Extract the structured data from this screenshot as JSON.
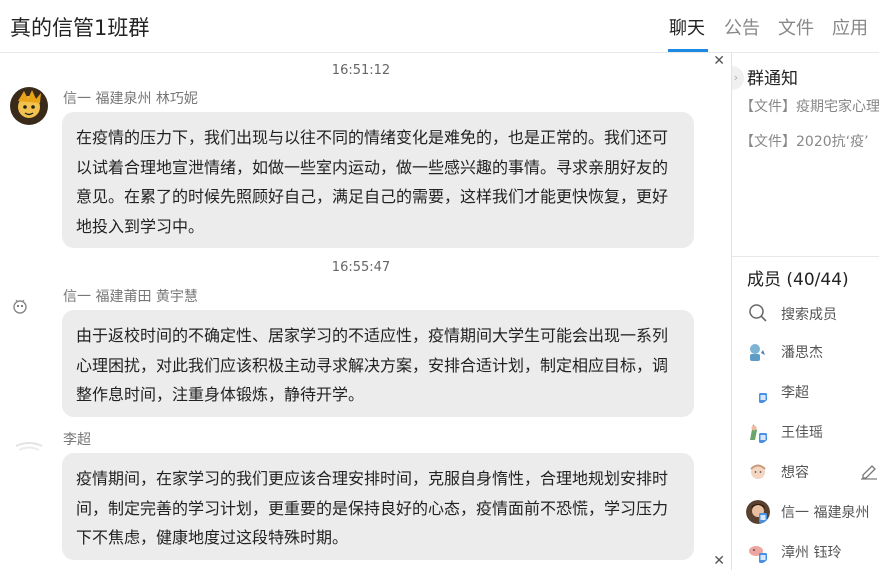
{
  "header": {
    "group_title": "真的信管1班群",
    "tabs": [
      {
        "label": "聊天",
        "active": true
      },
      {
        "label": "公告",
        "active": false
      },
      {
        "label": "文件",
        "active": false
      },
      {
        "label": "应用",
        "active": false
      }
    ],
    "accent_color": "#1e88e5"
  },
  "chat": {
    "messages": [
      {
        "time": "16:51:12",
        "sender": "信一 福建泉州 林巧妮",
        "text": "在疫情的压力下，我们出现与以往不同的情绪变化是难免的，也是正常的。我们还可以试着合理地宣泄情绪，如做一些室内运动，做一些感兴趣的事情。寻求亲朋好友的意见。在累了的时候先照顾好自己，满足自己的需要，这样我们才能更快恢复，更好地投入到学习中。"
      },
      {
        "time": "16:55:47",
        "sender": "信一 福建莆田 黄宇慧",
        "text": "由于返校时间的不确定性、居家学习的不适应性，疫情期间大学生可能会出现一系列心理困扰，对此我们应该积极主动寻求解决方案，安排合适计划，制定相应目标，调整作息时间，注重身体锻炼，静待开学。"
      },
      {
        "time": "",
        "sender": "李超",
        "text": "疫情期间，在家学习的我们更应该合理安排时间，克服自身惰性，合理地规划安排时间，制定完善的学习计划，更重要的是保持良好的心态，疫情面前不恐慌，学习压力下不焦虑，健康地度过这段特殊时期。"
      }
    ]
  },
  "side": {
    "notice_title": "群通知",
    "notices": [
      "【文件】疫期宅家心理",
      "【文件】2020抗‘疫’"
    ],
    "members_title": "成员 (40/44)",
    "search_placeholder": "搜索成员",
    "members": [
      "潘思杰",
      "李超",
      "王佳瑶",
      "想容",
      "信一 福建泉州",
      "漳州 钰玲"
    ]
  }
}
